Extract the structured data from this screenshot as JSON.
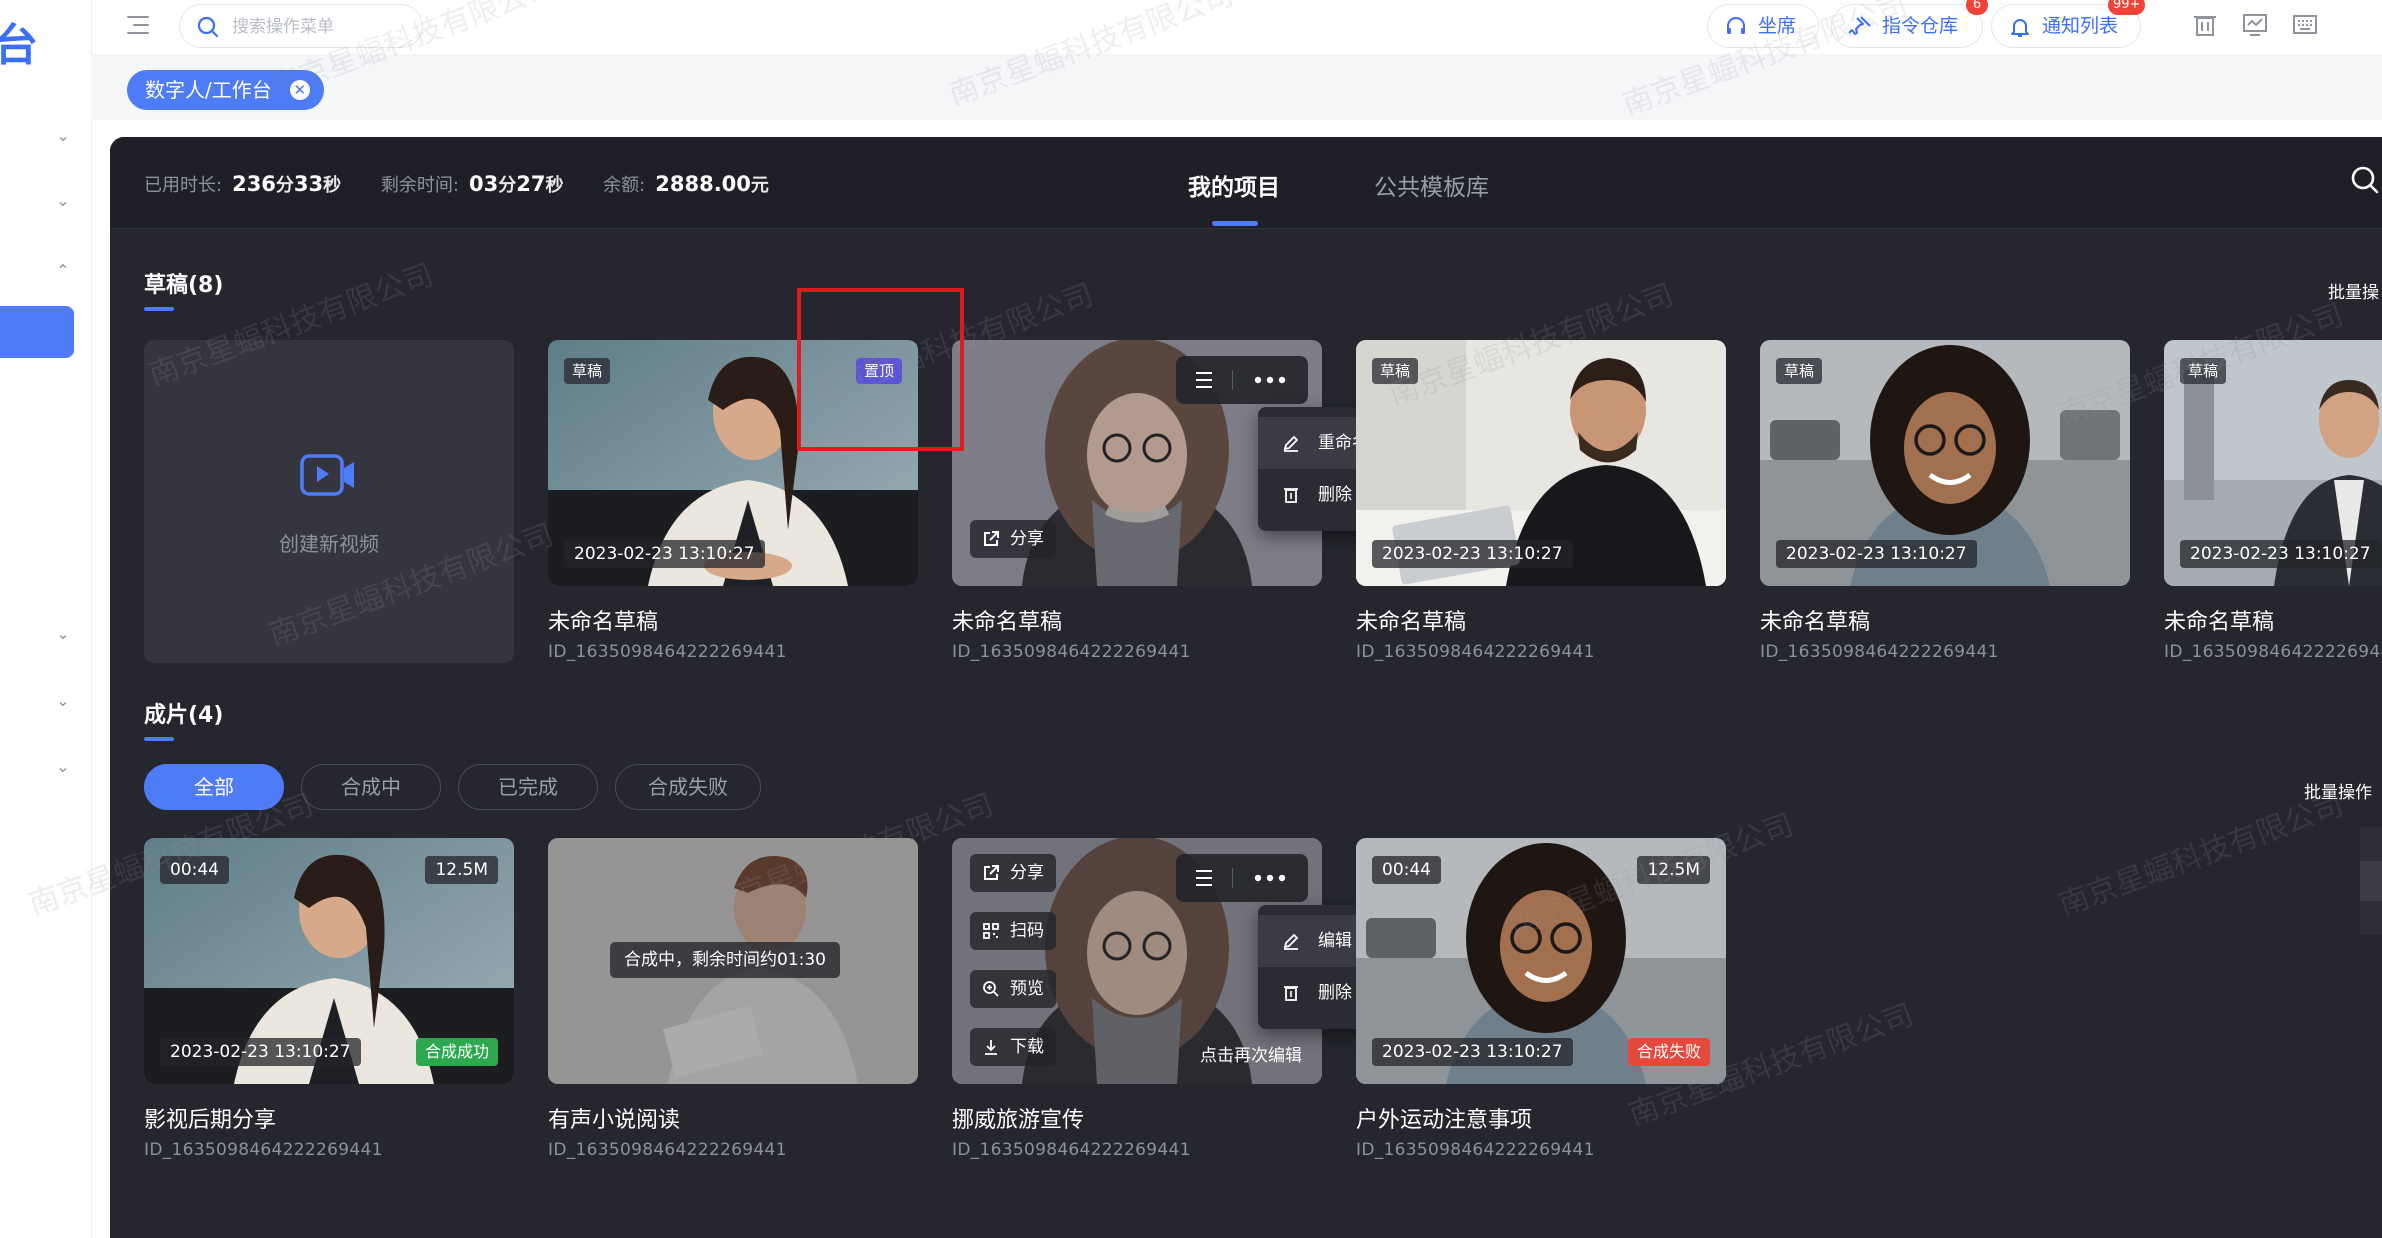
{
  "sidebar": {
    "logo_fragment": "台"
  },
  "header": {
    "search_placeholder": "搜索操作菜单",
    "seat_label": "坐席",
    "command_label": "指令仓库",
    "command_badge": "6",
    "notify_label": "通知列表",
    "notify_badge": "99+",
    "tool_icons": [
      "trash-icon",
      "monitor-icon",
      "keyboard-icon"
    ]
  },
  "tagstrip": {
    "active_tag": "数字人/工作台"
  },
  "stats": {
    "used_label": "已用时长:",
    "used_min": "236",
    "used_min_unit": "分",
    "used_sec": "33",
    "used_sec_unit": "秒",
    "remain_label": "剩余时间:",
    "remain_min": "03",
    "remain_min_unit": "分",
    "remain_sec": "27",
    "remain_sec_unit": "秒",
    "balance_label": "余额:",
    "balance_value": "2888.00",
    "balance_unit": "元"
  },
  "tabs": [
    {
      "label": "我的项目",
      "active": true
    },
    {
      "label": "公共模板库",
      "active": false
    }
  ],
  "drafts": {
    "title": "草稿(8)",
    "batch_label": "批量操",
    "create_label": "创建新视频",
    "label_draft": "草稿",
    "label_pinned": "置顶",
    "share_label": "分享",
    "menu": [
      {
        "label": "重命名",
        "icon": "edit-icon"
      },
      {
        "label": "删除",
        "icon": "trash-icon"
      }
    ],
    "items": [
      {
        "title": "未命名草稿",
        "id": "ID_1635098464222269441",
        "date": "2023-02-23 13:10:27"
      },
      {
        "title": "未命名草稿",
        "id": "ID_1635098464222269441",
        "date": ""
      },
      {
        "title": "未命名草稿",
        "id": "ID_1635098464222269441",
        "date": "2023-02-23 13:10:27"
      },
      {
        "title": "未命名草稿",
        "id": "ID_1635098464222269441",
        "date": "2023-02-23 13:10:27"
      },
      {
        "title": "未命名草稿",
        "id": "ID_163509846422226944",
        "date": "2023-02-23 13:10:27"
      }
    ]
  },
  "finished": {
    "title": "成片(4)",
    "batch_label": "批量操作",
    "filters": [
      {
        "label": "全部",
        "active": true
      },
      {
        "label": "合成中",
        "active": false
      },
      {
        "label": "已完成",
        "active": false
      },
      {
        "label": "合成失败",
        "active": false
      }
    ],
    "overlay_buttons": [
      {
        "label": "分享",
        "icon": "share-icon"
      },
      {
        "label": "扫码",
        "icon": "qrcode-icon"
      },
      {
        "label": "预览",
        "icon": "zoom-icon"
      },
      {
        "label": "下载",
        "icon": "download-icon"
      }
    ],
    "reedit_hint": "点击再次编辑",
    "menu": [
      {
        "label": "编辑",
        "icon": "edit-icon"
      },
      {
        "label": "删除",
        "icon": "trash-icon"
      }
    ],
    "items": [
      {
        "title": "影视后期分享",
        "id": "ID_1635098464222269441",
        "duration": "00:44",
        "size": "12.5M",
        "date": "2023-02-23 13:10:27",
        "status": "合成成功"
      },
      {
        "title": "有声小说阅读",
        "id": "ID_1635098464222269441",
        "progress_text": "合成中，剩余时间约01:30"
      },
      {
        "title": "挪威旅游宣传",
        "id": "ID_1635098464222269441"
      },
      {
        "title": "户外运动注意事项",
        "id": "ID_1635098464222269441",
        "duration": "00:44",
        "size": "12.5M",
        "date": "2023-02-23 13:10:27",
        "status": "合成失败"
      }
    ]
  },
  "watermark": "南京星蝠科技有限公司",
  "colors": {
    "accent": "#4e7bf6",
    "panel": "#25262e",
    "success": "#2ea84f",
    "fail": "#e5483d",
    "pinned": "#5b55d6",
    "highlight_box": "#e01b1b"
  }
}
